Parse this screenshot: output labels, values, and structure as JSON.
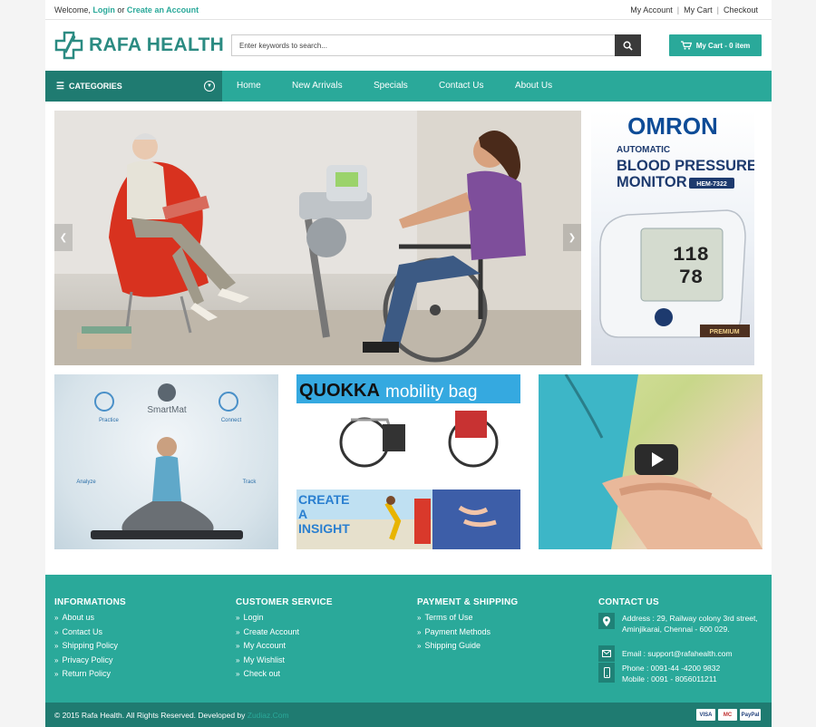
{
  "topbar": {
    "welcome_prefix": "Welcome,",
    "login_label": "Login",
    "or_text": "or",
    "create_label": "Create an Account",
    "links": [
      "My Account",
      "My Cart",
      "Checkout"
    ]
  },
  "header": {
    "logo_text": "RAFA HEALTH",
    "search_placeholder": "Enter keywords to search...",
    "cart_label": "My Cart - 0 item"
  },
  "nav": {
    "categories_label": "CATEGORIES",
    "items": [
      "Home",
      "New Arrivals",
      "Specials",
      "Contact Us",
      "About Us"
    ]
  },
  "banners": {
    "omron": {
      "brand": "OMRON",
      "line1": "AUTOMATIC",
      "line2": "BLOOD PRESSURE",
      "line3": "MONITOR",
      "model": "HEM-7322",
      "badge": "PREMIUM",
      "reading1": "118",
      "reading2": "78"
    },
    "smartmat": {
      "brand": "SmartMat",
      "practice": "Practice",
      "connect": "Connect",
      "analyze": "Analyze",
      "track": "Track"
    },
    "quokka": {
      "brand": "QUOKKA",
      "tagline": "mobility bag"
    },
    "insight": {
      "line1": "CREATE",
      "line2": "A",
      "line3": "INSIGHT"
    }
  },
  "footer": {
    "informations": {
      "title": "INFORMATIONS",
      "items": [
        "About us",
        "Contact Us",
        "Shipping Policy",
        "Privacy Policy",
        "Return Policy"
      ]
    },
    "customer_service": {
      "title": "CUSTOMER SERVICE",
      "items": [
        "Login",
        "Create Account",
        "My Account",
        "My Wishlist",
        "Check out"
      ]
    },
    "payment_shipping": {
      "title": "PAYMENT & SHIPPING",
      "items": [
        "Terms of Use",
        "Payment Methods",
        "Shipping Guide"
      ]
    },
    "contact": {
      "title": "CONTACT US",
      "address_line1": "Address : 29, Railway colony 3rd street,",
      "address_line2": "Aminjikarai, Chennai - 600 029.",
      "email": "Email : support@rafahealth.com",
      "phone": "Phone : 0091-44 -4200 9832",
      "mobile": "Mobile : 0091 - 8056011211"
    },
    "copyright": "© 2015 Rafa Health. All Rights Reserved. Developed by",
    "developer": "Zudiaz.Com",
    "payments": [
      "VISA",
      "MC",
      "PayPal"
    ]
  },
  "colors": {
    "accent": "#2aa99a",
    "accent_dark": "#1f7b71"
  }
}
